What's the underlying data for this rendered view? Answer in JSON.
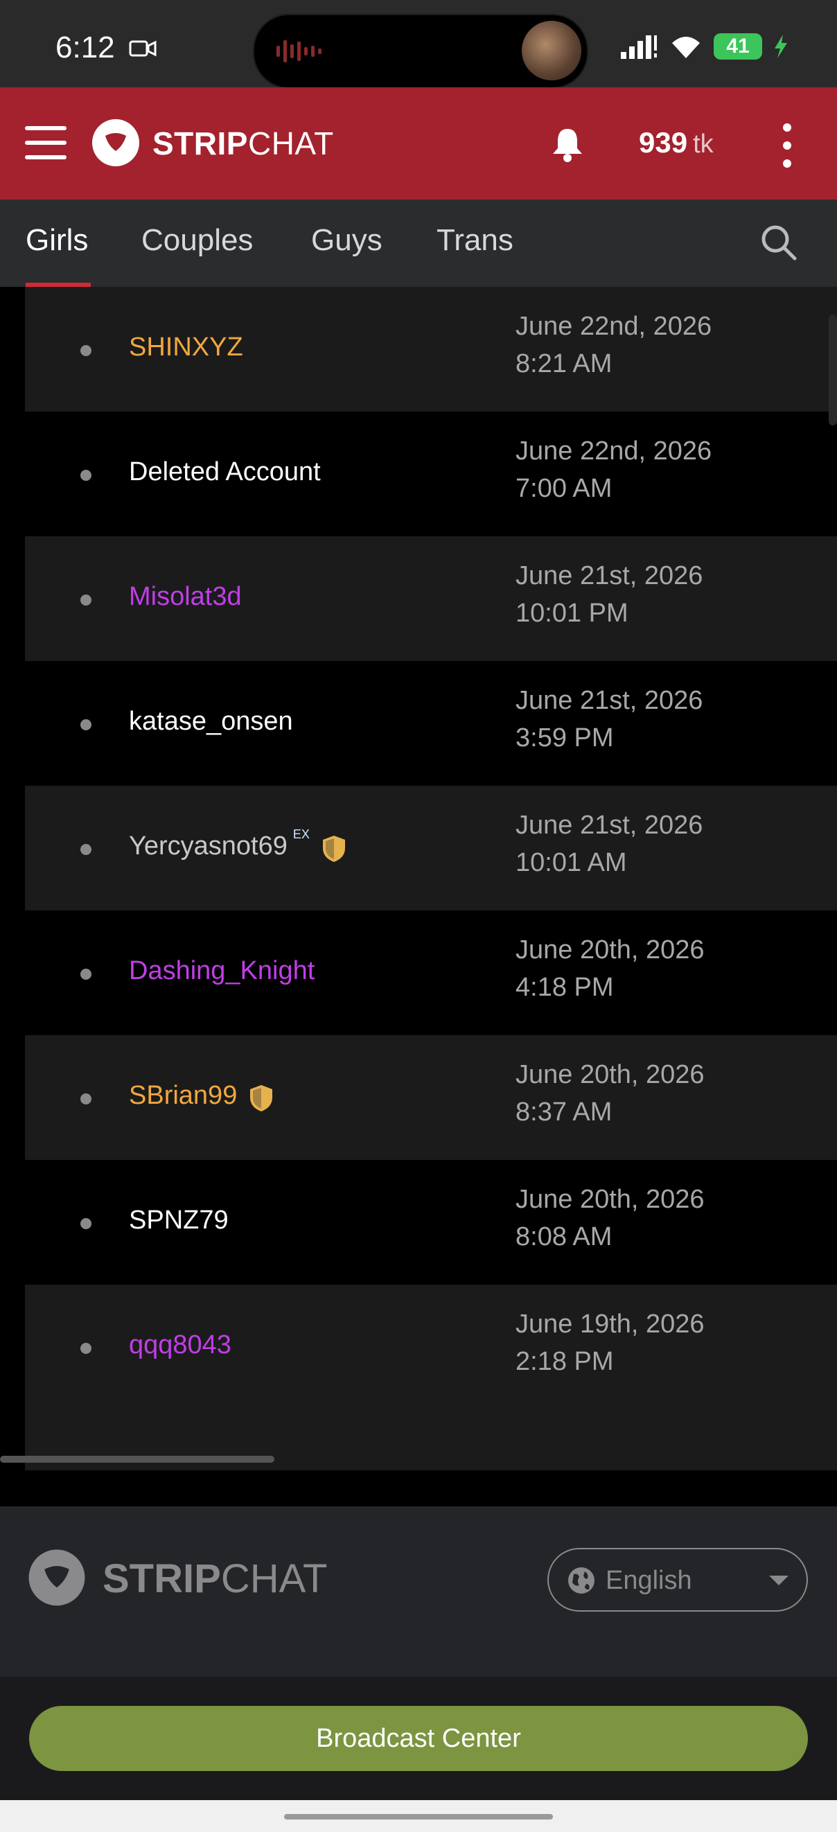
{
  "status_bar": {
    "time": "6:12",
    "battery": "41"
  },
  "header": {
    "brand_bold": "STRIP",
    "brand_rest": "CHAT",
    "tokens_value": "939",
    "tokens_unit": "tk"
  },
  "tabs": [
    {
      "label": "Girls",
      "active": true
    },
    {
      "label": "Couples",
      "active": false
    },
    {
      "label": "Guys",
      "active": false
    },
    {
      "label": "Trans",
      "active": false
    }
  ],
  "rows": [
    {
      "username": "SHINXYZ",
      "color": "#f0a83e",
      "date": "June 22nd, 2026",
      "time": "8:21 AM"
    },
    {
      "username": "Deleted Account",
      "color": "#ffffff",
      "date": "June 22nd, 2026",
      "time": "7:00 AM"
    },
    {
      "username": "Misolat3d",
      "color": "#c13ee6",
      "date": "June 21st, 2026",
      "time": "10:01 PM"
    },
    {
      "username": "katase_onsen",
      "color": "#ffffff",
      "date": "June 21st, 2026",
      "time": "3:59 PM"
    },
    {
      "username": "Yercyasnot69",
      "color": "#c8c8c8",
      "badge": "EX",
      "date": "June 21st, 2026",
      "time": "10:01 AM"
    },
    {
      "username": "Dashing_Knight",
      "color": "#c13ee6",
      "date": "June 20th, 2026",
      "time": "4:18 PM"
    },
    {
      "username": "SBrian99",
      "color": "#f0a83e",
      "date": "June 20th, 2026",
      "time": "8:37 AM"
    },
    {
      "username": "SPNZ79",
      "color": "#ffffff",
      "date": "June 20th, 2026",
      "time": "8:08 AM"
    },
    {
      "username": "qqq8043",
      "color": "#c13ee6",
      "date": "June 19th, 2026",
      "time": "2:18 PM"
    }
  ],
  "footer": {
    "brand_bold": "STRIP",
    "brand_rest": "CHAT",
    "language": "English",
    "broadcast_label": "Broadcast Center"
  },
  "colors": {
    "header_red": "#a3222d",
    "tab_accent": "#d12a36",
    "broadcast_green": "#7d9441",
    "model_orange": "#f0a83e",
    "model_magenta": "#c13ee6"
  }
}
